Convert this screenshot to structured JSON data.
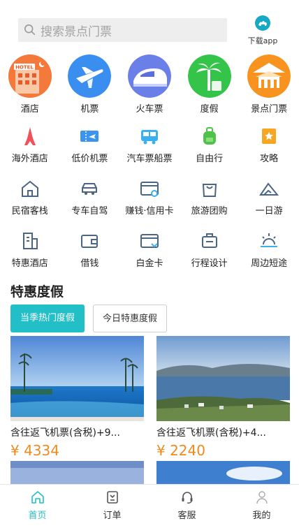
{
  "search": {
    "placeholder": "搜索景点门票"
  },
  "download": {
    "label": "下载app"
  },
  "main_icons": [
    {
      "label": "酒店",
      "icon": "hotel-icon"
    },
    {
      "label": "机票",
      "icon": "airplane-icon"
    },
    {
      "label": "火车票",
      "icon": "train-icon"
    },
    {
      "label": "度假",
      "icon": "vacation-icon"
    },
    {
      "label": "景点门票",
      "icon": "attraction-icon"
    }
  ],
  "grid": [
    [
      {
        "label": "海外酒店",
        "icon": "eiffel-tower-icon"
      },
      {
        "label": "低价机票",
        "icon": "cheap-ticket-icon"
      },
      {
        "label": "汽车票船票",
        "icon": "bus-icon"
      },
      {
        "label": "自由行",
        "icon": "backpack-icon"
      },
      {
        "label": "攻略",
        "icon": "guide-icon"
      }
    ],
    [
      {
        "label": "民宿客栈",
        "icon": "homestay-icon"
      },
      {
        "label": "专车自驾",
        "icon": "car-icon"
      },
      {
        "label": "赚钱·信用卡",
        "icon": "credit-card-icon"
      },
      {
        "label": "旅游团购",
        "icon": "shopping-bag-icon"
      },
      {
        "label": "一日游",
        "icon": "mountain-icon"
      }
    ],
    [
      {
        "label": "特惠酒店",
        "icon": "building-icon"
      },
      {
        "label": "借钱",
        "icon": "wallet-icon"
      },
      {
        "label": "白金卡",
        "icon": "platinum-card-icon"
      },
      {
        "label": "行程设计",
        "icon": "luggage-icon"
      },
      {
        "label": "周边短途",
        "icon": "sunrise-icon"
      }
    ]
  ],
  "section": {
    "title": "特惠度假",
    "tabs": [
      "当季热门度假",
      "今日特惠度假"
    ]
  },
  "cards": [
    {
      "name": "含往返飞机票(含税)+9...",
      "price": "¥ 4334"
    },
    {
      "name": "含往返飞机票(含税)+4...",
      "price": "¥ 2240"
    }
  ],
  "nav": [
    {
      "label": "首页",
      "icon": "home-icon",
      "active": true
    },
    {
      "label": "订单",
      "icon": "order-icon"
    },
    {
      "label": "客服",
      "icon": "headset-icon"
    },
    {
      "label": "我的",
      "icon": "user-icon"
    }
  ],
  "colors": {
    "accent": "#22bfc6",
    "price": "#f08a1c"
  }
}
